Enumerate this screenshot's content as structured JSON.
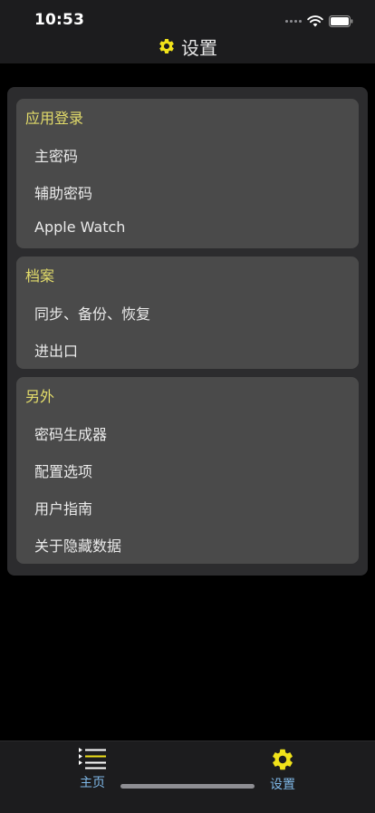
{
  "status_bar": {
    "time": "10:53"
  },
  "header": {
    "title": "设置",
    "icon": "gear-icon"
  },
  "sections": [
    {
      "title": "应用登录",
      "items": [
        "主密码",
        "辅助密码",
        "Apple Watch"
      ]
    },
    {
      "title": "档案",
      "items": [
        "同步、备份、恢复",
        "进出口"
      ]
    },
    {
      "title": "另外",
      "items": [
        "密码生成器",
        "配置选项",
        "用户指南",
        "关于隐藏数据"
      ]
    }
  ],
  "tabbar": {
    "tabs": [
      {
        "label": "主页",
        "icon": "list-icon"
      },
      {
        "label": "设置",
        "icon": "gear-icon"
      }
    ]
  },
  "colors": {
    "accent_yellow": "#e3dc6a",
    "tab_label": "#7fb8e8",
    "card_bg": "#4a4a4a",
    "panel_bg": "#2c2c2e"
  }
}
